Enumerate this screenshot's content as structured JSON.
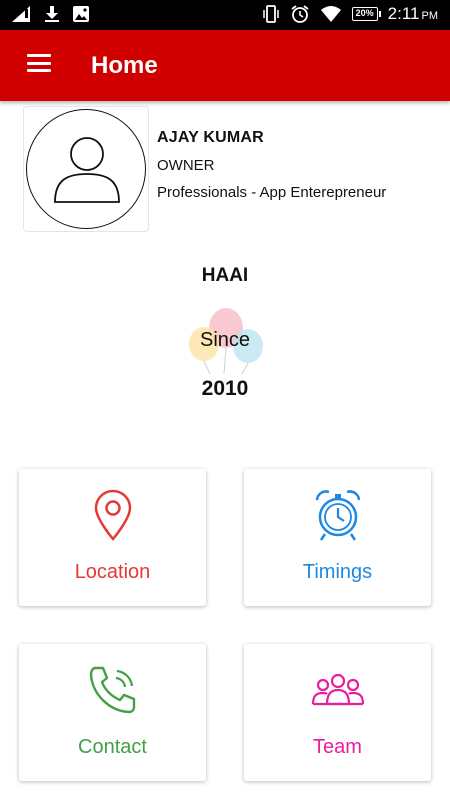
{
  "status_bar": {
    "time": "2:11",
    "ampm": "PM",
    "battery": "20%"
  },
  "app_bar": {
    "title": "Home"
  },
  "profile": {
    "name": "AJAY KUMAR",
    "role": "OWNER",
    "company": "Professionals - App Enterepreneur"
  },
  "business": {
    "name": "HAAI",
    "since_label": "Since",
    "since_year": "2010"
  },
  "cards": [
    {
      "label": "Location",
      "icon": "location-pin-icon",
      "color": "#e53935"
    },
    {
      "label": "Timings",
      "icon": "alarm-clock-icon",
      "color": "#1e88e5"
    },
    {
      "label": "Contact",
      "icon": "phone-ringing-icon",
      "color": "#43a047"
    },
    {
      "label": "Team",
      "icon": "group-icon",
      "color": "#e91e9e"
    }
  ],
  "colors": {
    "app_bar": "#d00000",
    "status_bar": "#000000"
  }
}
